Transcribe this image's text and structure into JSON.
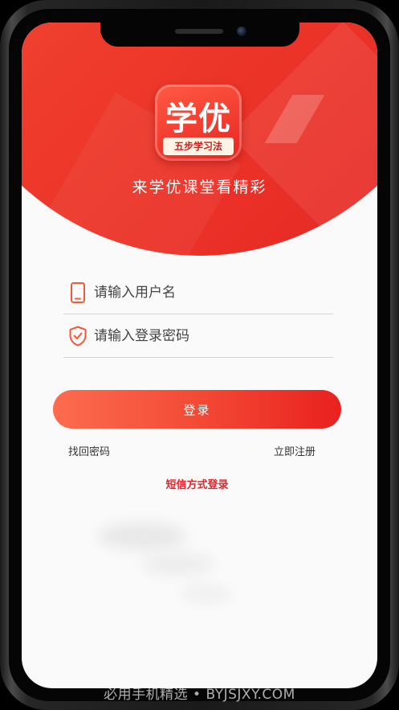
{
  "app": {
    "logo_text": "学优",
    "logo_ribbon": "五步学习法",
    "tagline": "来学优课堂看精彩"
  },
  "form": {
    "username_placeholder": "请输入用户名",
    "password_placeholder": "请输入登录密码",
    "login_label": "登录"
  },
  "links": {
    "forgot": "找回密码",
    "register": "立即注册",
    "sms_login": "短信方式登录"
  },
  "watermark": "必用手机精选 • BYJSJXY.COM",
  "colors": {
    "accent": "#ee3a2b",
    "accent_light": "#fd6c4e",
    "link_red": "#e0262a"
  },
  "icons": {
    "username": "phone-icon",
    "password": "shield-check-icon"
  }
}
